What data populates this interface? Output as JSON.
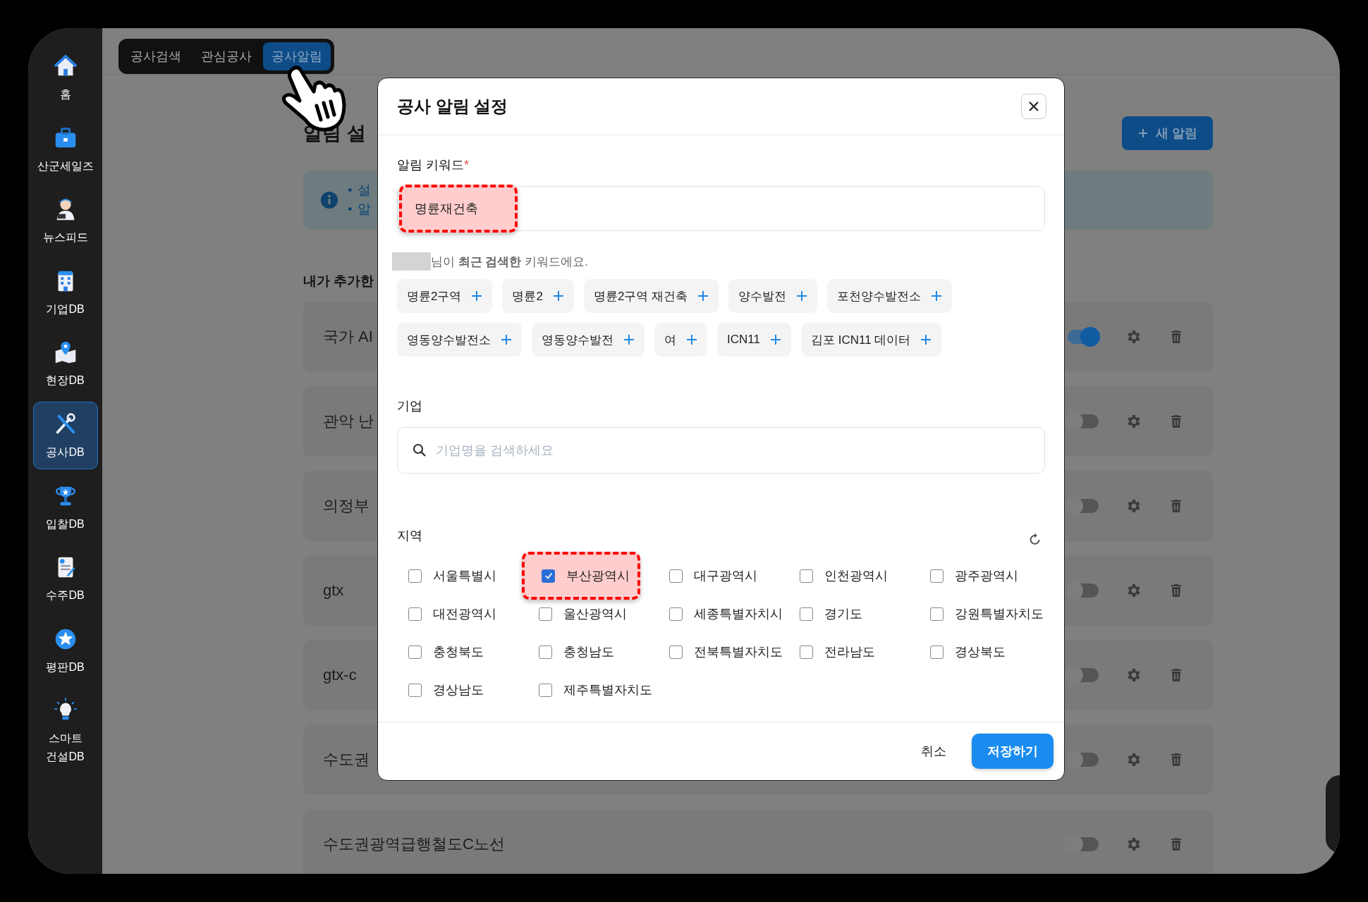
{
  "sidebar": {
    "items": [
      {
        "label": "홈",
        "selected": false
      },
      {
        "label": "산군세일즈",
        "selected": false
      },
      {
        "label": "뉴스피드",
        "selected": false
      },
      {
        "label": "기업DB",
        "selected": false
      },
      {
        "label": "현장DB",
        "selected": false
      },
      {
        "label": "공사DB",
        "selected": true
      },
      {
        "label": "입찰DB",
        "selected": false
      },
      {
        "label": "수주DB",
        "selected": false
      },
      {
        "label": "평판DB",
        "selected": false
      },
      {
        "label": "스마트 건설DB",
        "selected": false
      }
    ]
  },
  "nav_tabs": [
    {
      "label": "공사검색",
      "selected": false
    },
    {
      "label": "관심공사",
      "selected": false
    },
    {
      "label": "공사알림",
      "selected": true
    }
  ],
  "page": {
    "heading": "알림 설",
    "new_button": "새 알림",
    "info_lines": [
      {
        "bullet": "•",
        "text": "설"
      },
      {
        "bullet": "•",
        "text": "알"
      }
    ],
    "list_title": "내가 추가한",
    "rows": [
      {
        "title": "국가 AI",
        "on": true
      },
      {
        "title": "관악 난",
        "on": false
      },
      {
        "title": "의정부",
        "on": false
      },
      {
        "title": "gtx",
        "on": false
      },
      {
        "title": "gtx-c",
        "on": false
      },
      {
        "title": "수도권",
        "on": false
      },
      {
        "title": "수도권광역급행철도C노선",
        "on": false
      }
    ]
  },
  "modal": {
    "title": "공사 알림 설정",
    "keyword": {
      "label": "알림 키워드",
      "required_mark": "*",
      "value": "명륜재건축",
      "highlighted": true
    },
    "name_redacted": true,
    "recent_hint": "님이 **최근 검색한** 키워드에요.",
    "recent_keywords": [
      "명륜2구역",
      "명륜2",
      "명륜2구역 재건축",
      "양수발전",
      "포천양수발전소",
      "영동양수발전소",
      "영동양수발전",
      "여",
      "ICN11",
      "김포 ICN11 데이터"
    ],
    "company": {
      "label": "기업",
      "placeholder": "기업명을 검색하세요"
    },
    "region": {
      "label": "지역",
      "options": [
        {
          "label": "서울특별시",
          "checked": false,
          "highlighted": false
        },
        {
          "label": "부산광역시",
          "checked": true,
          "highlighted": true
        },
        {
          "label": "대구광역시",
          "checked": false,
          "highlighted": false
        },
        {
          "label": "인천광역시",
          "checked": false,
          "highlighted": false
        },
        {
          "label": "광주광역시",
          "checked": false,
          "highlighted": false
        },
        {
          "label": "대전광역시",
          "checked": false,
          "highlighted": false
        },
        {
          "label": "울산광역시",
          "checked": false,
          "highlighted": false
        },
        {
          "label": "세종특별자치시",
          "checked": false,
          "highlighted": false
        },
        {
          "label": "경기도",
          "checked": false,
          "highlighted": false
        },
        {
          "label": "강원특별자치도",
          "checked": false,
          "highlighted": false
        },
        {
          "label": "충청북도",
          "checked": false,
          "highlighted": false
        },
        {
          "label": "충청남도",
          "checked": false,
          "highlighted": false
        },
        {
          "label": "전북특별자치도",
          "checked": false,
          "highlighted": false
        },
        {
          "label": "전라남도",
          "checked": false,
          "highlighted": false
        },
        {
          "label": "경상북도",
          "checked": false,
          "highlighted": false
        },
        {
          "label": "경상남도",
          "checked": false,
          "highlighted": false
        },
        {
          "label": "제주특별자치도",
          "checked": false,
          "highlighted": false
        }
      ]
    },
    "cancel_button": "취소",
    "save_button": "저장하기"
  }
}
